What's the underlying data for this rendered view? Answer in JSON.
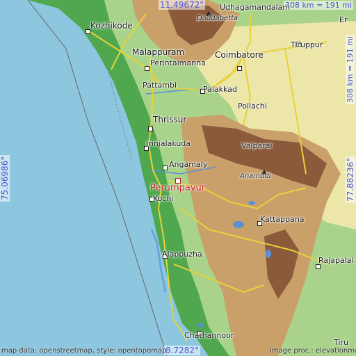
{
  "map": {
    "focus_place": "Perumpavur",
    "colors": {
      "sea": "#8cc6df",
      "lowland": "#4fa84e",
      "midland": "#a9d38a",
      "plateau": "#ece6a8",
      "hills": "#c9a06a",
      "mountains": "#8a5a3a",
      "roads": "#e8d23a",
      "focus": "#d0202a",
      "coords": "#4a55d8"
    },
    "coords": {
      "top": "11.49672°",
      "bottom": "8.7282°",
      "left": "75.06986°",
      "right": "77.88236°"
    },
    "scale": {
      "top": "308 km = 191 mi",
      "right": "308 km = 191 mi"
    },
    "cities": {
      "udhagamandalam": "Udhagamandalam",
      "kozhikode": "Kozhikode",
      "malappuram": "Malappuram",
      "perintalmanna": "Perintalmanna",
      "coimbatore": "Coimbatore",
      "tiruppur": "Tiruppur",
      "er": "Er",
      "pattambi": "Pattambi",
      "palakkad": "Palakkad",
      "pollachi": "Pollachi",
      "thrissur": "Thrissur",
      "irinjalakuda": "Irinjalakuda",
      "valparai": "Valparai",
      "angamaly": "Angamaly",
      "kochi": "Kochi",
      "kattappana": "Kattappana",
      "rajapalai": "Rajapalai",
      "alappuzha": "Alappuzha",
      "chathannoor": "Chathannoor",
      "tiru": "Tiru"
    },
    "peaks": {
      "doddabetta": "Doddabetta",
      "anamudi": "Anamudi"
    },
    "attribution_left": "map data: openstreetmap, style: opentopomap",
    "attribution_right": "image proc.: elevationmap"
  }
}
